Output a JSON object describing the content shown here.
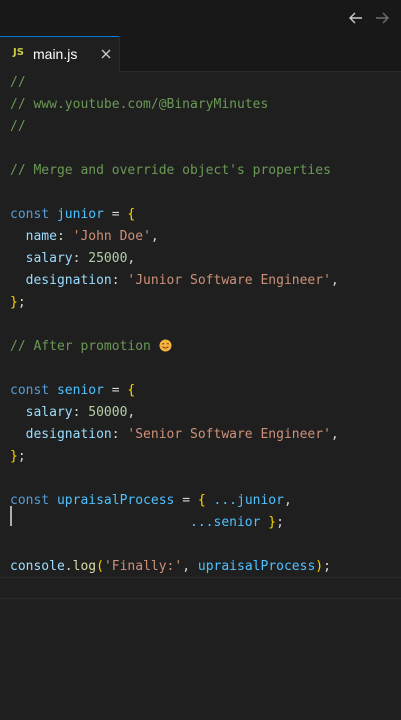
{
  "titlebar": {
    "back_icon": "arrow-left-icon",
    "forward_icon": "arrow-right-icon"
  },
  "tab": {
    "icon_text": "JS",
    "label": "main.js",
    "close_icon": "close-icon"
  },
  "colors": {
    "background": "#1f1f1f",
    "comment": "#6a9955",
    "keyword": "#569cd6",
    "variable": "#4fc1ff",
    "property": "#9cdcfe",
    "string": "#ce9178",
    "number": "#b5cea8",
    "brace": "#ffd700",
    "paren": "#da70d6",
    "function": "#dcdcaa"
  },
  "code": {
    "c1": "//",
    "c2": "// www.youtube.com/@BinaryMinutes",
    "c3": "//",
    "c4": "// Merge and override object's properties",
    "kw_const": "const",
    "junior": "junior",
    "eq": " = ",
    "lbrace": "{",
    "rbrace": "}",
    "semi": ";",
    "comma": ",",
    "colon": ": ",
    "indent": "  ",
    "p_name": "name",
    "v_name": "'John Doe'",
    "p_salary": "salary",
    "v_salary_junior": "25000",
    "p_designation": "designation",
    "v_designation_junior": "'Junior Software Engineer'",
    "c5": "// After promotion ",
    "c5_emoji": "smiling-face-emoji-icon",
    "senior": "senior",
    "v_salary_senior": "50000",
    "v_designation_senior": "'Senior Software Engineer'",
    "upraisal": "upraisalProcess",
    "spread_junior": "...junior",
    "spread_senior": "...senior",
    "pad_senior": "                       ",
    "console": "console",
    "dot": ".",
    "log": "log",
    "lparen": "(",
    "rparen": ")",
    "v_finally": "'Finally:'",
    "space": " ",
    "comma_space": ", "
  }
}
